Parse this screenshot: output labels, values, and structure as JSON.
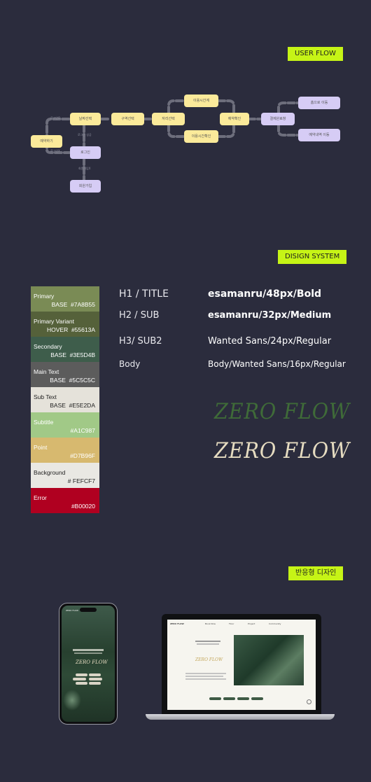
{
  "sections": {
    "user_flow_tag": "USER FLOW",
    "design_system_tag": "DISIGN SYSTEM",
    "responsive_tag": "반응형 디자인"
  },
  "flow": {
    "nodes": {
      "booking": "예약하기",
      "branch_select": "날짜선택",
      "login": "로그인",
      "signup": "회원가입",
      "zone_select": "구역선택",
      "seat_select": "자리선택",
      "time_select": "이용시간계",
      "time_confirm": "이용시간확인",
      "reserve_confirm": "예약확인",
      "payment": "결제완료창",
      "home_move": "홈으로 이동",
      "mypage_move": "예약내역 이동"
    },
    "labels": {
      "logged_in": "로그인O",
      "logged_out": "로그인X",
      "login_success": "로그인 성공",
      "no_account": "회원가입X"
    }
  },
  "palette": [
    {
      "name": "Primary",
      "state": "BASE",
      "hex": "#7A8B55",
      "color": "#7a8b55",
      "text": "#ffffff"
    },
    {
      "name": "Primary Variant",
      "state": "HOVER",
      "hex": "#55613A",
      "color": "#55613a",
      "text": "#ffffff"
    },
    {
      "name": "Secondary",
      "state": "BASE",
      "hex": "#3E5D4B",
      "color": "#3e5d4b",
      "text": "#ffffff"
    },
    {
      "name": "Main Text",
      "state": "BASE",
      "hex": "#5C5C5C",
      "color": "#5c5c5c",
      "text": "#ffffff"
    },
    {
      "name": "Sub Text",
      "state": "BASE",
      "hex": "#E5E2DA",
      "color": "#e5e2da",
      "text": "#222222"
    },
    {
      "name": "Subtitle",
      "state": "",
      "hex": "#A1C987",
      "color": "#a1c987",
      "text": "#ffffff"
    },
    {
      "name": "Point",
      "state": "",
      "hex": "#D7B96F",
      "color": "#d7b96f",
      "text": "#ffffff"
    },
    {
      "name": "Background",
      "state": "",
      "hex": "# FEFCF7",
      "color": "#e9e8e3",
      "text": "#222222"
    },
    {
      "name": "Error",
      "state": "",
      "hex": "#B00020",
      "color": "#b00020",
      "text": "#ffffff"
    }
  ],
  "typography": [
    {
      "level": "H1 / TITLE",
      "spec": "esamanru/48px/Bold"
    },
    {
      "level": "H2 / SUB",
      "spec": "esamanru/32px/Medium"
    },
    {
      "level": "H3/ SUB2",
      "spec": "Wanted Sans/24px/Regular"
    },
    {
      "level": "Body",
      "spec": "Body/Wanted Sans/16px/Regular"
    }
  ],
  "logos": {
    "green": "ZERO FLOW",
    "cream": "ZERO FLOW",
    "green_color": "#3f6b38",
    "cream_color": "#e6dcc1"
  },
  "devices": {
    "phone_brand": "ZERO FLOW",
    "phone_logo": "ZERO FLOW",
    "laptop_brand": "ZERO FLOW",
    "laptop_nav": [
      "Book Now",
      "Floor",
      "Project",
      "Community"
    ],
    "laptop_logo": "ZERO FLOW"
  }
}
